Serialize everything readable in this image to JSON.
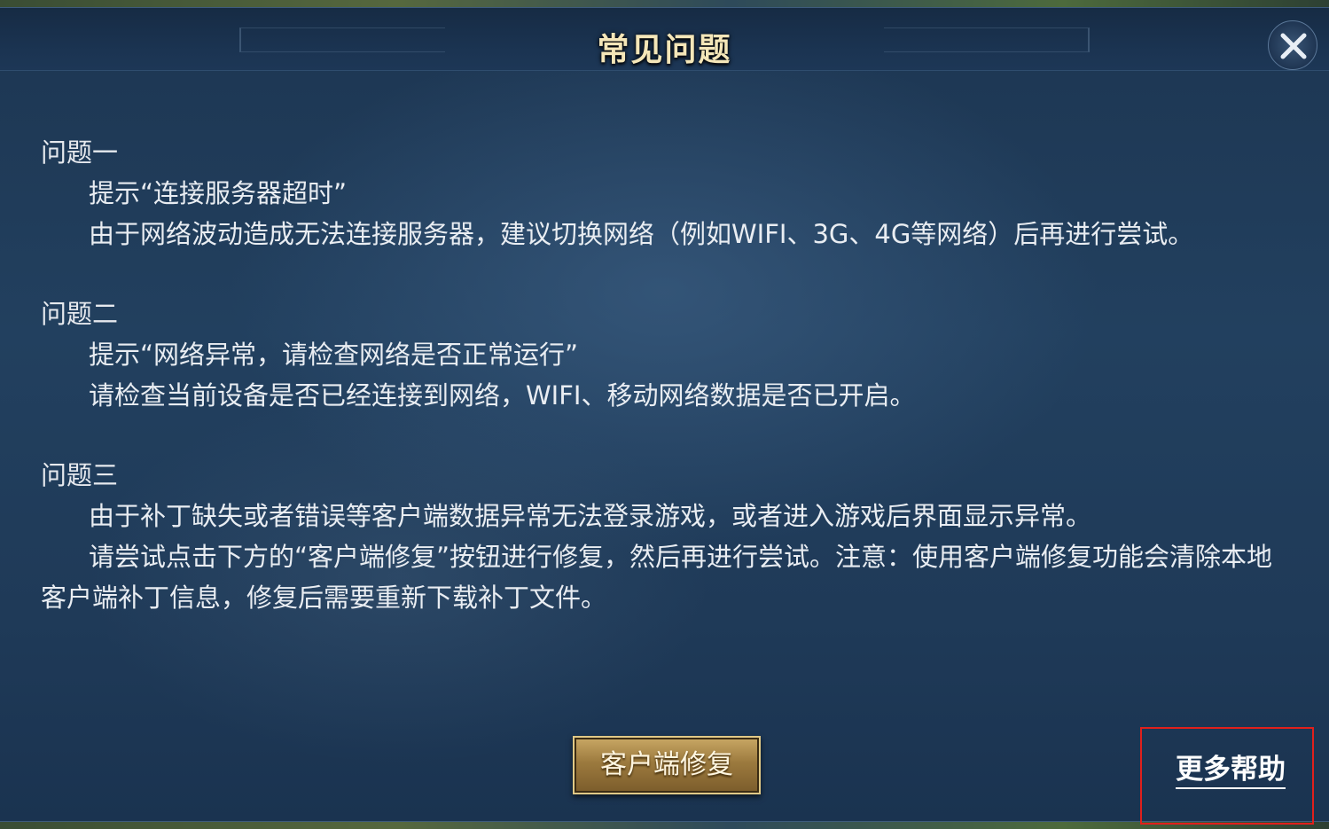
{
  "dialog": {
    "title": "常见问题",
    "close_icon": "close-x-icon"
  },
  "faq": [
    {
      "heading": "问题一",
      "lines": [
        "提示“连接服务器超时”",
        "由于网络波动造成无法连接服务器，建议切换网络（例如WIFI、3G、4G等网络）后再进行尝试。"
      ]
    },
    {
      "heading": "问题二",
      "lines": [
        "提示“网络异常，请检查网络是否正常运行”",
        "请检查当前设备是否已经连接到网络，WIFI、移动网络数据是否已开启。"
      ]
    },
    {
      "heading": "问题三",
      "lines": [
        "由于补丁缺失或者错误等客户端数据异常无法登录游戏，或者进入游戏后界面显示异常。",
        "请尝试点击下方的“客户端修复”按钮进行修复，然后再进行尝试。注意：使用客户端修复功能会清除本地客户端补丁信息，修复后需要重新下载补丁文件。"
      ]
    }
  ],
  "footer": {
    "repair_button_label": "客户端修复",
    "more_help_label": "更多帮助"
  },
  "colors": {
    "title_gold": "#f4e6b8",
    "button_gold": "#c9a865",
    "highlight_red": "#e0201c"
  }
}
